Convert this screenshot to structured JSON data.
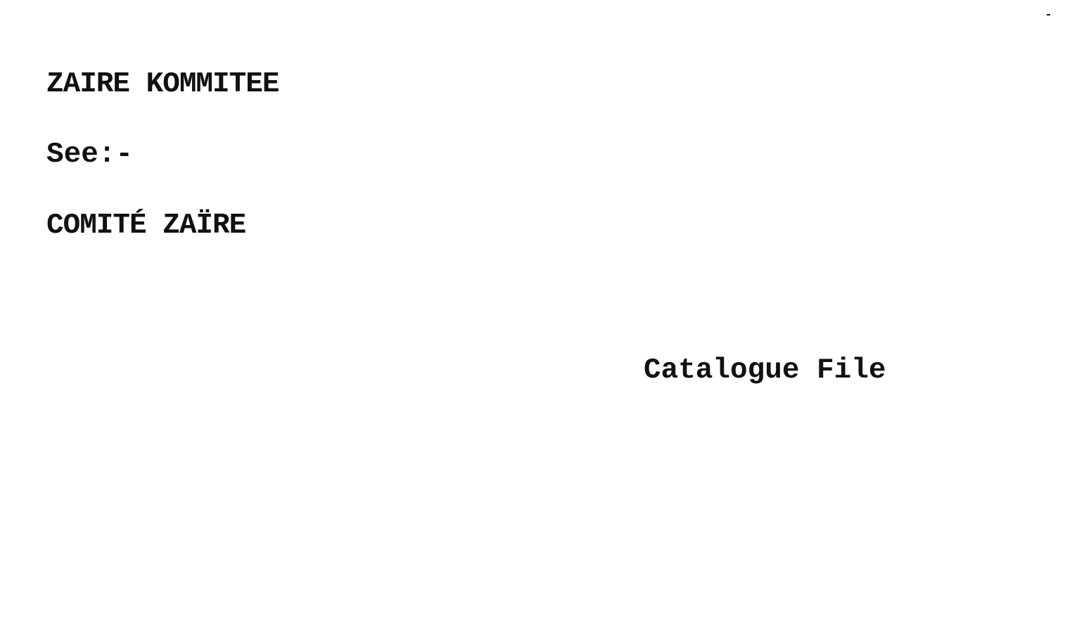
{
  "card": {
    "heading": "ZAIRE KOMMITEE",
    "see_label": "See:-",
    "cross_reference": "COMITÉ ZAÏRE",
    "file_label": "Catalogue File"
  },
  "colors": {
    "paper": "#ffffff",
    "ink": "#111111"
  }
}
